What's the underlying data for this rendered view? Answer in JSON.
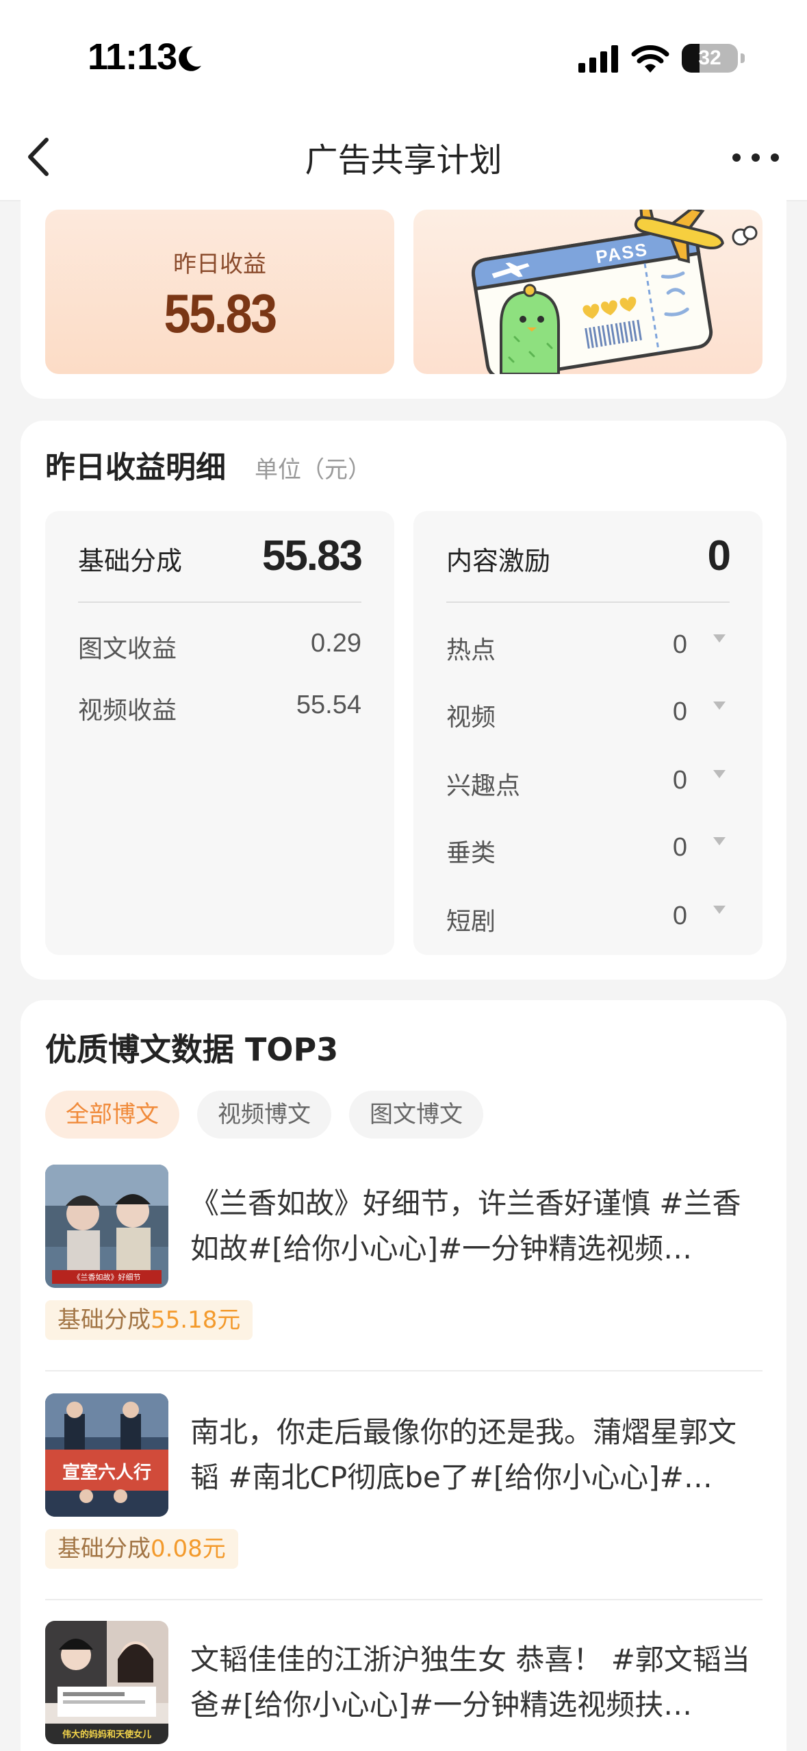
{
  "status_bar": {
    "time": "11:13",
    "battery": "32",
    "battery_fraction": 0.32
  },
  "nav": {
    "title": "广告共享计划"
  },
  "summary": {
    "yesterday_label": "昨日收益",
    "yesterday_value": "55.83"
  },
  "detail": {
    "title": "昨日收益明细",
    "unit": "单位（元）",
    "base": {
      "label": "基础分成",
      "value": "55.83",
      "rows": [
        {
          "label": "图文收益",
          "value": "0.29"
        },
        {
          "label": "视频收益",
          "value": "55.54"
        }
      ]
    },
    "incentive": {
      "label": "内容激励",
      "value": "0",
      "rows": [
        {
          "label": "热点",
          "value": "0"
        },
        {
          "label": "视频",
          "value": "0"
        },
        {
          "label": "兴趣点",
          "value": "0"
        },
        {
          "label": "垂类",
          "value": "0"
        },
        {
          "label": "短剧",
          "value": "0"
        }
      ]
    }
  },
  "top3": {
    "title": "优质博文数据 TOP3",
    "tabs": [
      "全部博文",
      "视频博文",
      "图文博文"
    ],
    "posts": [
      {
        "text": "《兰香如故》好细节，许兰香好谨慎 #兰香如故#[给你小心心]#一分钟精选视频…",
        "thumb_caption": "《兰香如故》好细节",
        "earn_prefix": "基础分成",
        "earn_amount": "55.18元"
      },
      {
        "text": "南北，你走后最像你的还是我。蒲熠星郭文韬 #南北CP彻底be了#[给你小心心]#…",
        "thumb_caption": "宣室六人行",
        "earn_prefix": "基础分成",
        "earn_amount": "0.08元"
      },
      {
        "text": "文韬佳佳的江浙沪独生女 恭喜！ #郭文韬当爸#[给你小心心]#一分钟精选视频扶…",
        "thumb_caption": "伟大的妈妈和天使女儿"
      }
    ]
  },
  "colors": {
    "accent": "#f08a3a",
    "earn": "#f39a2c",
    "summary_value": "#7a3615"
  }
}
